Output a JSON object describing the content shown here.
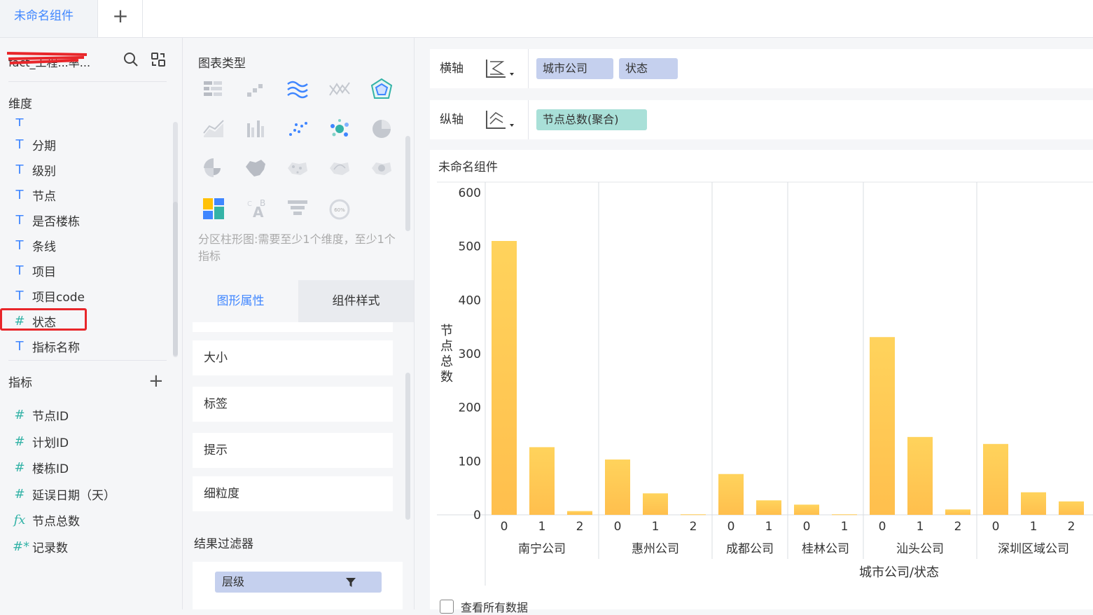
{
  "tabs": {
    "active": "未命名组件",
    "add_symbol": "+"
  },
  "dataset": {
    "name": "fact_工程...率..."
  },
  "dimensions": {
    "title": "维度",
    "fields": [
      {
        "type": "T",
        "name": "分期"
      },
      {
        "type": "T",
        "name": "级别"
      },
      {
        "type": "T",
        "name": "节点"
      },
      {
        "type": "T",
        "name": "是否楼栋"
      },
      {
        "type": "T",
        "name": "条线"
      },
      {
        "type": "T",
        "name": "项目"
      },
      {
        "type": "T",
        "name": "项目code"
      },
      {
        "type": "#",
        "name": "状态"
      },
      {
        "type": "T",
        "name": "指标名称"
      }
    ]
  },
  "metrics": {
    "title": "指标",
    "add_symbol": "+",
    "fields": [
      {
        "type": "#",
        "name": "节点ID"
      },
      {
        "type": "#",
        "name": "计划ID"
      },
      {
        "type": "#",
        "name": "楼栋ID"
      },
      {
        "type": "#",
        "name": "延误日期（天）"
      },
      {
        "type": "fx",
        "name": "节点总数"
      },
      {
        "type": "#*",
        "name": "记录数"
      }
    ]
  },
  "chart_types": {
    "title": "图表类型",
    "hint": "分区柱形图:需要至少1个维度，至少1个指标",
    "gauge_label": "60%"
  },
  "prop_tabs": {
    "active": "图形属性",
    "other": "组件样式"
  },
  "props": [
    "大小",
    "标签",
    "提示",
    "细粒度"
  ],
  "result_filter": {
    "title": "结果过滤器",
    "pill": "层级"
  },
  "axes": {
    "x": {
      "label": "横轴",
      "fields": [
        "城市公司",
        "状态"
      ]
    },
    "y": {
      "label": "纵轴",
      "fields": [
        "节点总数(聚合)"
      ]
    }
  },
  "view_all_label": "查看所有数据",
  "colors": {
    "accent": "#3f86ff",
    "bar_top": "#ffd35c",
    "bar_bottom": "#ffbf4d",
    "highlight": "#e8262a"
  },
  "chart_data": {
    "type": "bar",
    "title": "未命名组件",
    "xlabel": "城市公司/状态",
    "ylabel": "节点总数",
    "yticks": [
      0,
      100,
      200,
      300,
      400,
      500,
      600
    ],
    "ylim": [
      0,
      600
    ],
    "grid": false,
    "groups": [
      {
        "name": "南宁公司",
        "categories": [
          "0",
          "1",
          "2"
        ],
        "values": [
          510,
          126,
          7
        ]
      },
      {
        "name": "惠州公司",
        "categories": [
          "0",
          "1",
          "2"
        ],
        "values": [
          103,
          40,
          1
        ]
      },
      {
        "name": "成都公司",
        "categories": [
          "0",
          "1"
        ],
        "values": [
          76,
          27
        ]
      },
      {
        "name": "桂林公司",
        "categories": [
          "0",
          "1"
        ],
        "values": [
          19,
          1
        ]
      },
      {
        "name": "汕头公司",
        "categories": [
          "0",
          "1",
          "2"
        ],
        "values": [
          331,
          145,
          10
        ]
      },
      {
        "name": "深圳区域公司",
        "categories": [
          "0",
          "1",
          "2"
        ],
        "values": [
          132,
          42,
          25
        ]
      }
    ]
  }
}
